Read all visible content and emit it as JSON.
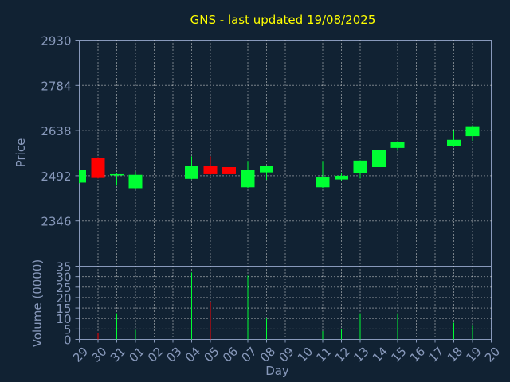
{
  "chart_data": [
    {
      "type": "candlestick",
      "title": "GNS - last updated 19/08/2025",
      "ylabel": "Price",
      "ylim": [
        2200,
        2930
      ],
      "yticks": [
        "2930",
        "2784",
        "2638",
        "2492",
        "2346"
      ],
      "ytick_values": [
        2930,
        2784,
        2638,
        2492,
        2346
      ],
      "grid": true,
      "colors": {
        "up": "#00ff33",
        "down": "#ff0000",
        "grid": "#dddddd",
        "axis": "#8899bb",
        "title": "#ffff00"
      },
      "candles": [
        {
          "day": "29",
          "open": 2470,
          "close": 2510,
          "high": 2512,
          "low": 2468
        },
        {
          "day": "30",
          "open": 2550,
          "close": 2485,
          "high": 2552,
          "low": 2483
        },
        {
          "day": "31",
          "open": 2495,
          "close": 2497,
          "high": 2500,
          "low": 2460
        },
        {
          "day": "01",
          "open": 2452,
          "close": 2495,
          "high": 2505,
          "low": 2450
        },
        {
          "day": "04",
          "open": 2482,
          "close": 2525,
          "high": 2555,
          "low": 2480
        },
        {
          "day": "05",
          "open": 2525,
          "close": 2497,
          "high": 2555,
          "low": 2495
        },
        {
          "day": "06",
          "open": 2520,
          "close": 2497,
          "high": 2555,
          "low": 2490
        },
        {
          "day": "07",
          "open": 2455,
          "close": 2510,
          "high": 2540,
          "low": 2453
        },
        {
          "day": "08",
          "open": 2503,
          "close": 2523,
          "high": 2524,
          "low": 2479
        },
        {
          "day": "11",
          "open": 2455,
          "close": 2487,
          "high": 2540,
          "low": 2453
        },
        {
          "day": "12",
          "open": 2480,
          "close": 2492,
          "high": 2500,
          "low": 2477
        },
        {
          "day": "13",
          "open": 2500,
          "close": 2541,
          "high": 2542,
          "low": 2483
        },
        {
          "day": "14",
          "open": 2520,
          "close": 2574,
          "high": 2576,
          "low": 2518
        },
        {
          "day": "15",
          "open": 2582,
          "close": 2601,
          "high": 2604,
          "low": 2573
        },
        {
          "day": "18",
          "open": 2587,
          "close": 2608,
          "high": 2640,
          "low": 2585
        },
        {
          "day": "19",
          "open": 2620,
          "close": 2652,
          "high": 2655,
          "low": 2605
        }
      ]
    },
    {
      "type": "bar",
      "ylabel": "Volume (0000)",
      "xlabel": "Day",
      "ylim": [
        0,
        35
      ],
      "yticks": [
        "35",
        "30",
        "25",
        "20",
        "15",
        "10",
        "5",
        "0"
      ],
      "ytick_values": [
        35,
        30,
        25,
        20,
        15,
        10,
        5,
        0
      ],
      "categories": [
        "29",
        "30",
        "31",
        "01",
        "02",
        "03",
        "04",
        "05",
        "06",
        "07",
        "08",
        "09",
        "10",
        "11",
        "12",
        "13",
        "14",
        "15",
        "16",
        "17",
        "18",
        "19",
        "20"
      ],
      "values": [
        0,
        3,
        12.5,
        4.5,
        0,
        0,
        32,
        18,
        13,
        30.5,
        10,
        0,
        0,
        4,
        5,
        12.5,
        10,
        12.5,
        0,
        0,
        8,
        6.5,
        0
      ],
      "colors": [
        "",
        "#ff0000",
        "#00ff33",
        "#00ff33",
        "",
        "",
        "#00ff33",
        "#ff0000",
        "#ff0000",
        "#00ff33",
        "#00ff33",
        "",
        "",
        "#00ff33",
        "#00ff33",
        "#00ff33",
        "#00ff33",
        "#00ff33",
        "",
        "",
        "#00ff33",
        "#00ff33",
        ""
      ]
    }
  ]
}
